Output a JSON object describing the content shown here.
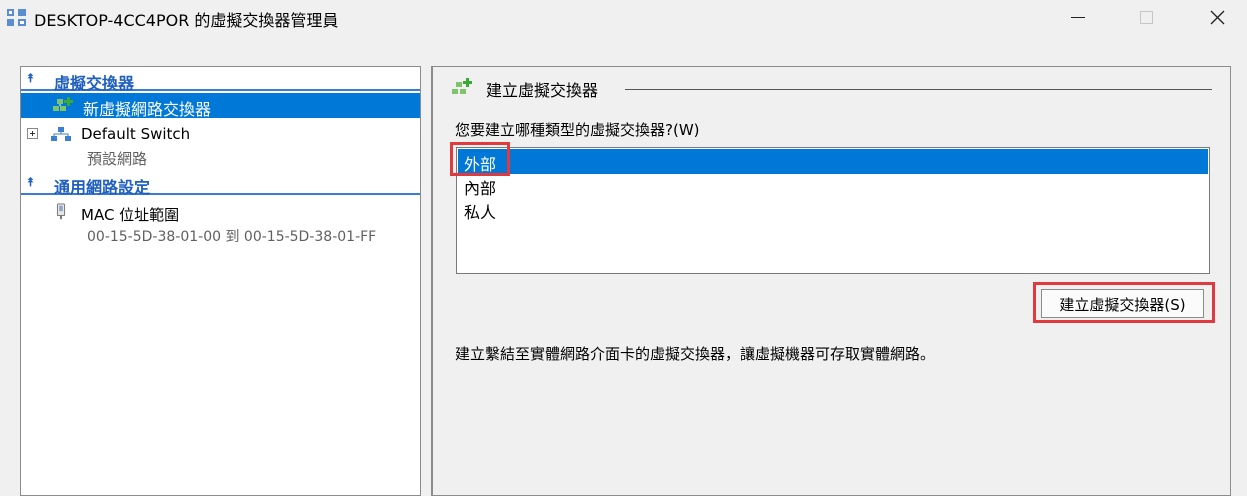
{
  "window": {
    "title": "DESKTOP-4CC4POR 的虛擬交換器管理員",
    "app_icon": "virtual-switch-manager-icon",
    "buttons": {
      "minimize": "minimize-icon",
      "maximize": "maximize-icon",
      "close": "close-icon"
    }
  },
  "sidebar": {
    "section_switches": "虛擬交換器",
    "new_switch": "新虛擬網路交換器",
    "default_switch": {
      "name": "Default Switch",
      "subtitle": "預設網路"
    },
    "section_global": "通用網路設定",
    "mac_range": {
      "name": "MAC 位址範圍",
      "value": "00-15-5D-38-01-00 到 00-15-5D-38-01-FF"
    }
  },
  "main": {
    "title": "建立虛擬交換器",
    "question": "您要建立哪種類型的虛擬交換器?(W)",
    "options": [
      "外部",
      "內部",
      "私人"
    ],
    "selected_option": "外部",
    "create_button": "建立虛擬交換器(S)",
    "description": "建立繫結至實體網路介面卡的虛擬交換器，讓虛擬機器可存取實體網路。"
  },
  "colors": {
    "selection": "#0078d7",
    "header": "#1f5fbf",
    "highlight": "#e0393e"
  }
}
